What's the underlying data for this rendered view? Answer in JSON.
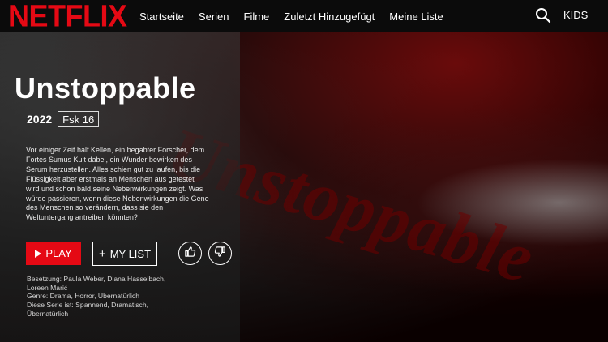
{
  "header": {
    "logo": "NETFLIX",
    "nav": [
      "Startseite",
      "Serien",
      "Filme",
      "Zuletzt Hinzugefügt",
      "Meine Liste"
    ],
    "kids_label": "KIDS",
    "search_icon": "search-icon"
  },
  "hero": {
    "background_text": "Unstoppable",
    "title": "Unstoppable",
    "year": "2022",
    "rating": "Fsk 16",
    "synopsis": "Vor einiger Zeit half Kellen, ein begabter Forscher, dem Fortes Sumus Kult dabei, ein Wunder bewirken des Serum herzustellen. Alles schien gut zu laufen, bis die Flüssigkeit aber erstmals an Menschen aus getestet wird und schon bald seine Nebenwirkungen zeigt. Was würde passieren, wenn diese Nebenwirkungen die Gene des Menschen so verändern, dass sie den Weltuntergang antreiben könnten?",
    "play_label": "PLAY",
    "mylist_label": "MY LIST",
    "thumbs_up_icon": "thumbs-up-icon",
    "thumbs_down_icon": "thumbs-down-icon",
    "cast": "Besetzung: Paula Weber, Diana Hasselbach, Loreen Marić",
    "genres": "Genre: Drama, Horror, Übernatürlich",
    "series_is": "Diese Serie ist: Spannend, Dramatisch, Übernatürlich"
  },
  "colors": {
    "brand_red": "#e50914",
    "topbar": "#0b0b0b",
    "text": "#ffffff"
  }
}
